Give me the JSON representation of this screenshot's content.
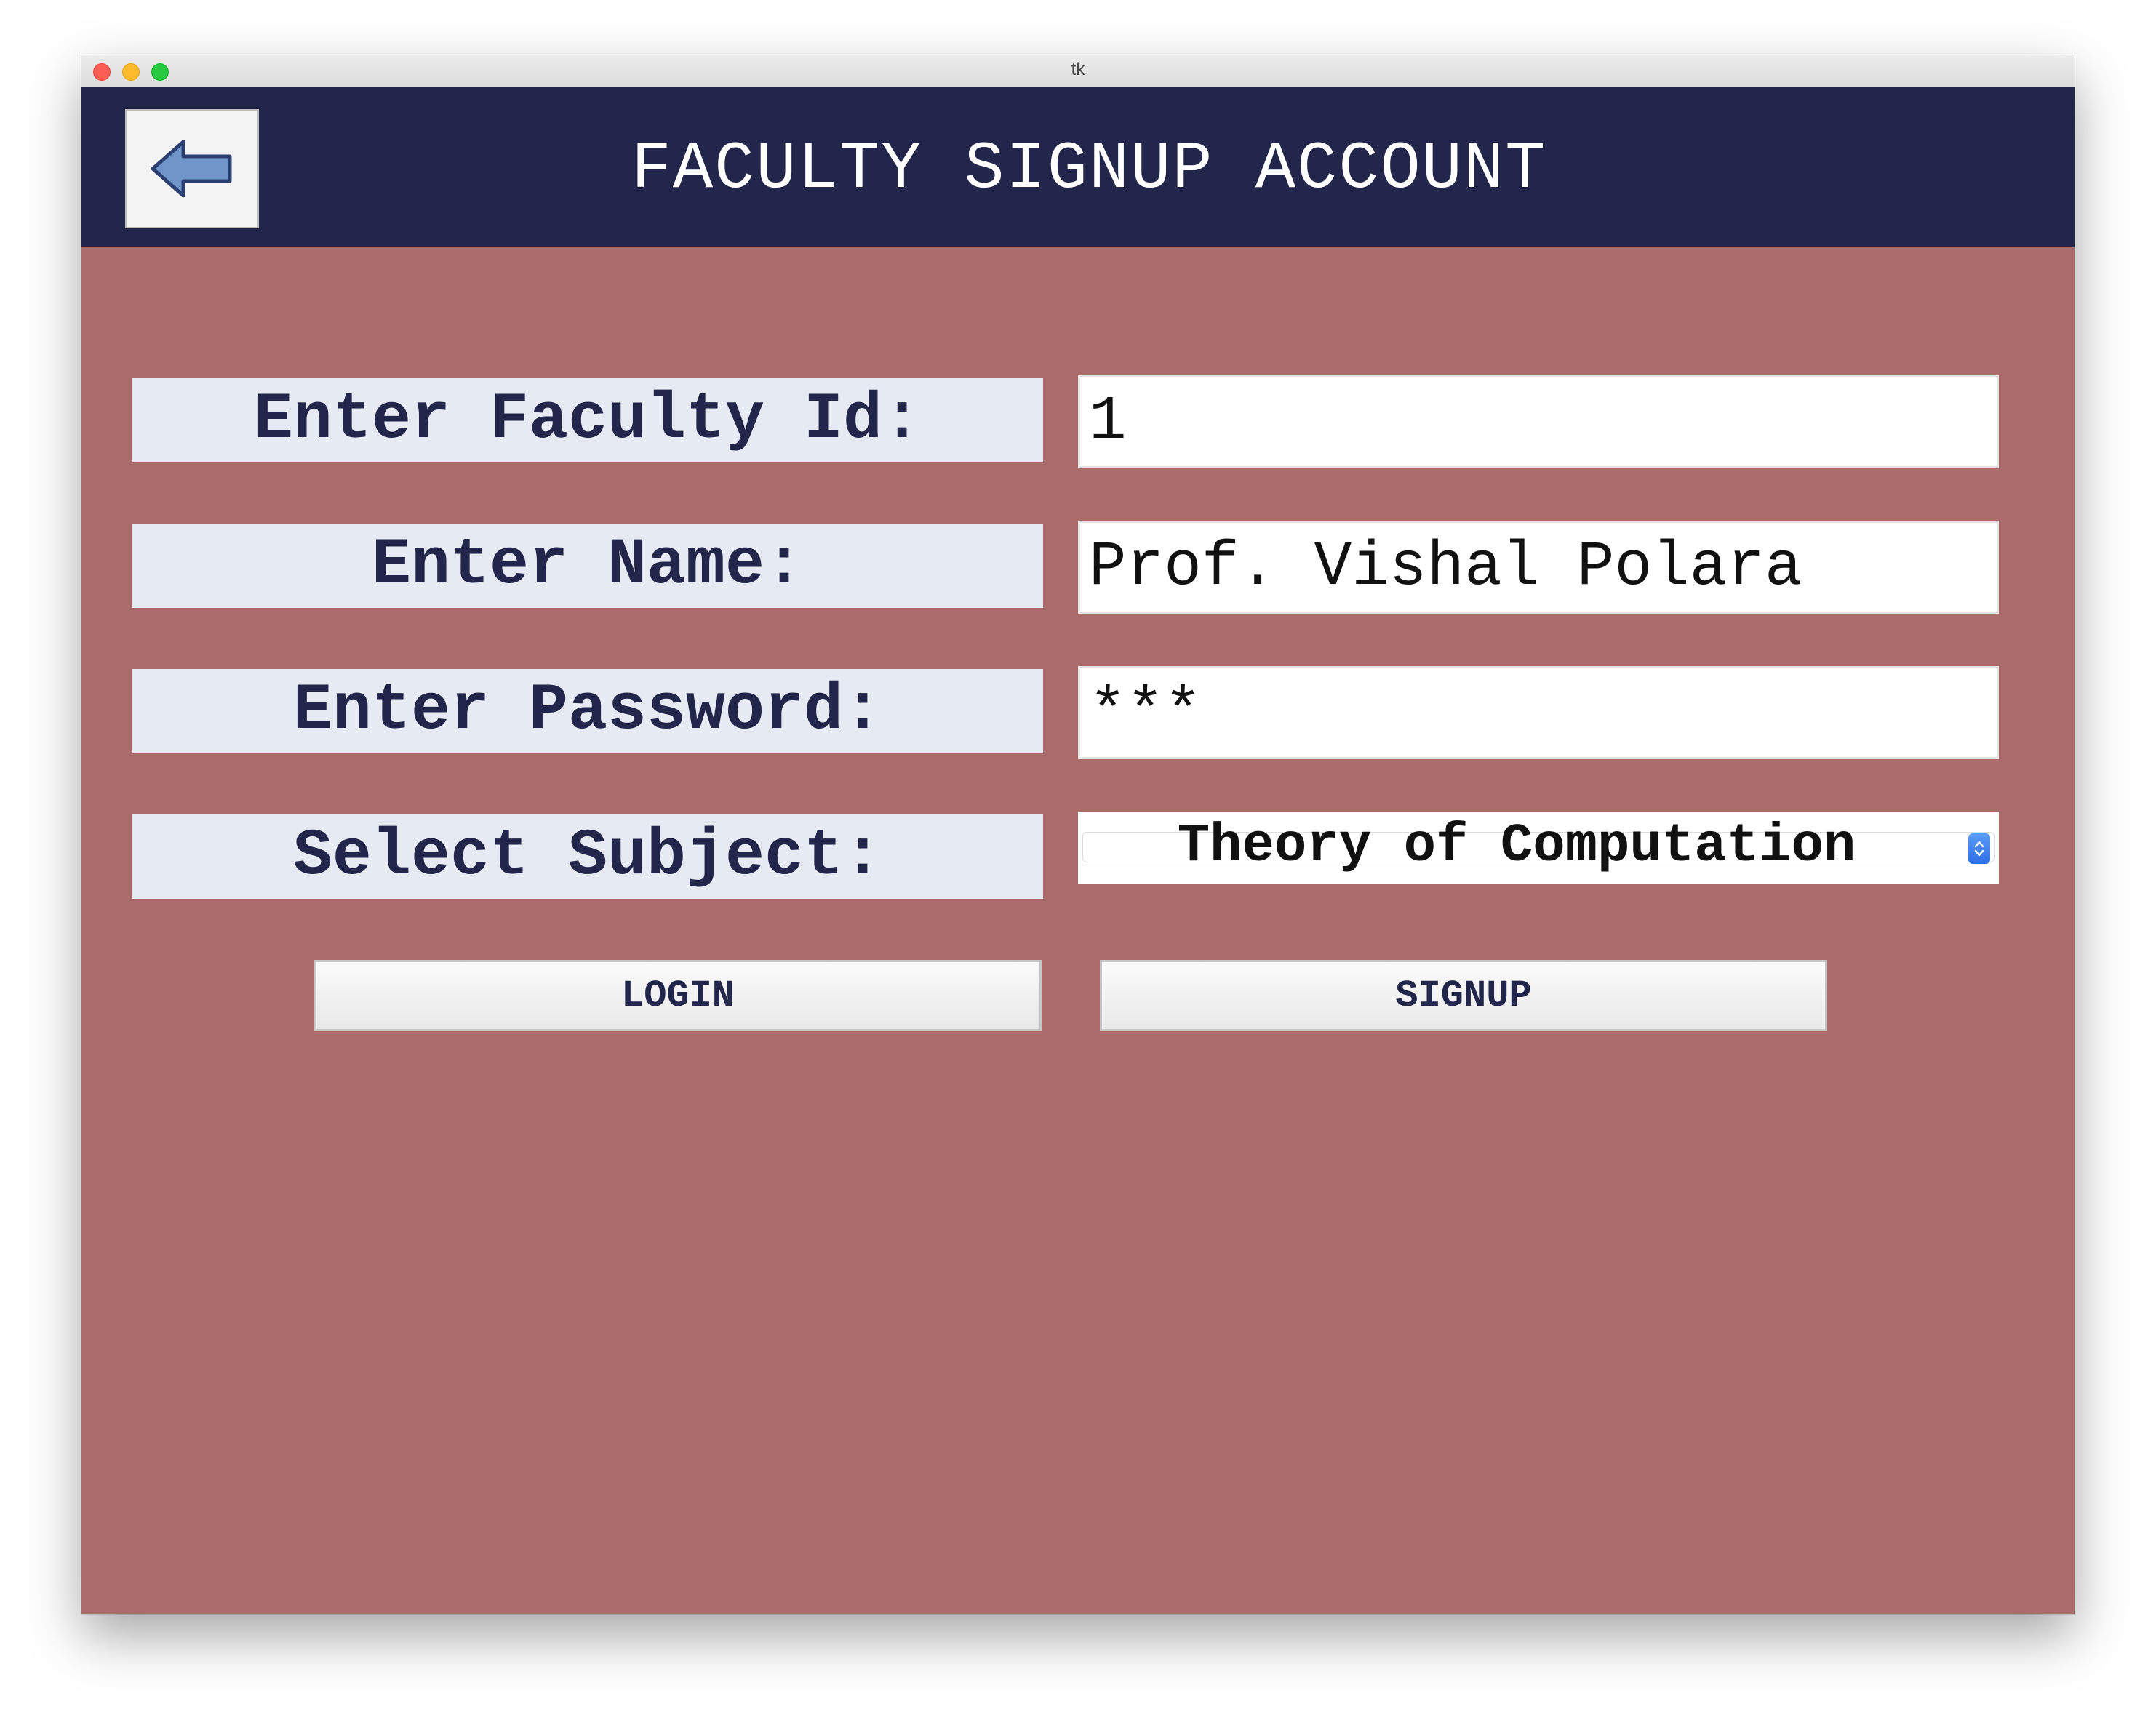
{
  "window": {
    "title": "tk"
  },
  "header": {
    "title": "FACULTY SIGNUP ACCOUNT",
    "back_icon": "arrow-left-icon"
  },
  "form": {
    "faculty_id": {
      "label": "Enter Faculty Id:",
      "value": "1"
    },
    "name": {
      "label": "Enter Name:",
      "value": "Prof. Vishal Polara"
    },
    "password": {
      "label": "Enter Password:",
      "value": "***"
    },
    "subject": {
      "label": "Select Subject:",
      "selected": "Theory of Computation"
    }
  },
  "buttons": {
    "login": "LOGIN",
    "signup": "SIGNUP"
  },
  "colors": {
    "header_bg": "#22264a",
    "body_bg": "#aa6c6b",
    "label_bg": "#e6eaf2",
    "text_dark": "#22264a",
    "select_accent": "#2d6fe6"
  }
}
